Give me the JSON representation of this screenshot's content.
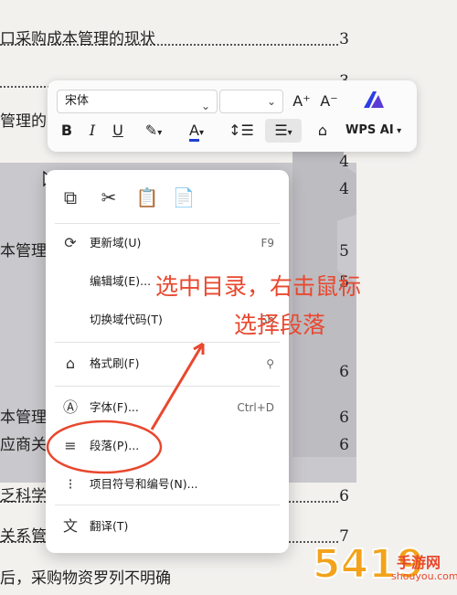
{
  "document": {
    "toc_lines": [
      {
        "text": "口采购成本管理的现状",
        "page": "3"
      },
      {
        "text": "",
        "page": "3"
      },
      {
        "text": "管理的",
        "page": ""
      },
      {
        "text": "",
        "page": "4"
      },
      {
        "text": "",
        "page": "4"
      },
      {
        "text": "",
        "page": ""
      },
      {
        "text": "本管理",
        "page": "5"
      },
      {
        "text": "",
        "page": ""
      },
      {
        "text": "",
        "page": "5"
      },
      {
        "text": "",
        "page": ""
      },
      {
        "text": "",
        "page": "6"
      },
      {
        "text": "",
        "page": ""
      },
      {
        "text": "本管理",
        "page": "6"
      },
      {
        "text": "应商关系",
        "page": "6"
      },
      {
        "text": "",
        "page": ""
      },
      {
        "text": "乏科学的",
        "page": "6"
      },
      {
        "text": "",
        "page": ""
      },
      {
        "text": "关系管理",
        "page": "7"
      },
      {
        "text": "后，采购物资罗列不明确",
        "page": ""
      }
    ]
  },
  "toolbar": {
    "font_name": "宋体",
    "grow_font": "A⁺",
    "shrink_font": "A⁻",
    "bold": "B",
    "italic": "I",
    "underline": "U",
    "font_color": "A",
    "wps_ai": "WPS AI"
  },
  "menu": {
    "items": [
      {
        "label": "更新域(U)",
        "shortcut": "F9"
      },
      {
        "label": "编辑域(E)...",
        "shortcut": ""
      },
      {
        "label": "切换域代码(T)",
        "shortcut": "Sh"
      },
      {
        "label": "格式刷(F)",
        "shortcut": ""
      },
      {
        "label": "字体(F)...",
        "shortcut": "Ctrl+D"
      },
      {
        "label": "段落(P)...",
        "shortcut": ""
      },
      {
        "label": "项目符号和编号(N)...",
        "shortcut": ""
      },
      {
        "label": "翻译(T)",
        "shortcut": ""
      }
    ]
  },
  "annotation": {
    "line1": "选中目录，右击鼠标",
    "line2": "选择段落",
    "color": "#e8482f"
  },
  "watermark": {
    "text": "手游网",
    "domain": "shouyou.com"
  }
}
